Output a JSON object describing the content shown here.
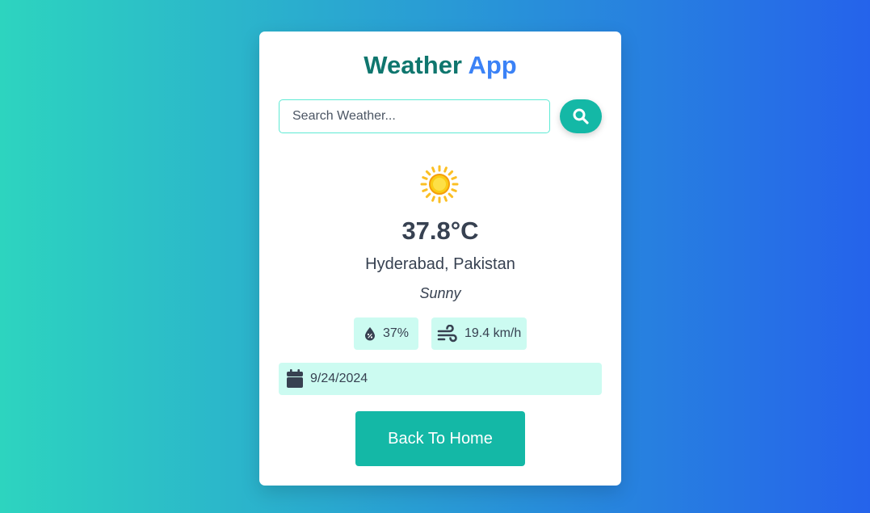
{
  "header": {
    "title_word1": "Weather",
    "title_word2": "App"
  },
  "search": {
    "placeholder": "Search Weather...",
    "value": "",
    "button_icon": "search-icon"
  },
  "weather": {
    "icon": "sun-icon",
    "temperature": "37.8°C",
    "location": "Hyderabad, Pakistan",
    "condition": "Sunny",
    "humidity": "37%",
    "humidity_icon": "humidity-drop-icon",
    "wind": "19.4 km/h",
    "wind_icon": "wind-icon",
    "date": "9/24/2024",
    "date_icon": "calendar-icon"
  },
  "actions": {
    "home_label": "Back To Home"
  },
  "colors": {
    "accent": "#14b8a6",
    "title_primary": "#0f766e",
    "title_secondary": "#3b82f6",
    "chip_bg": "#ccfbf1",
    "gradient_start": "#2dd4bf",
    "gradient_end": "#2563eb"
  }
}
